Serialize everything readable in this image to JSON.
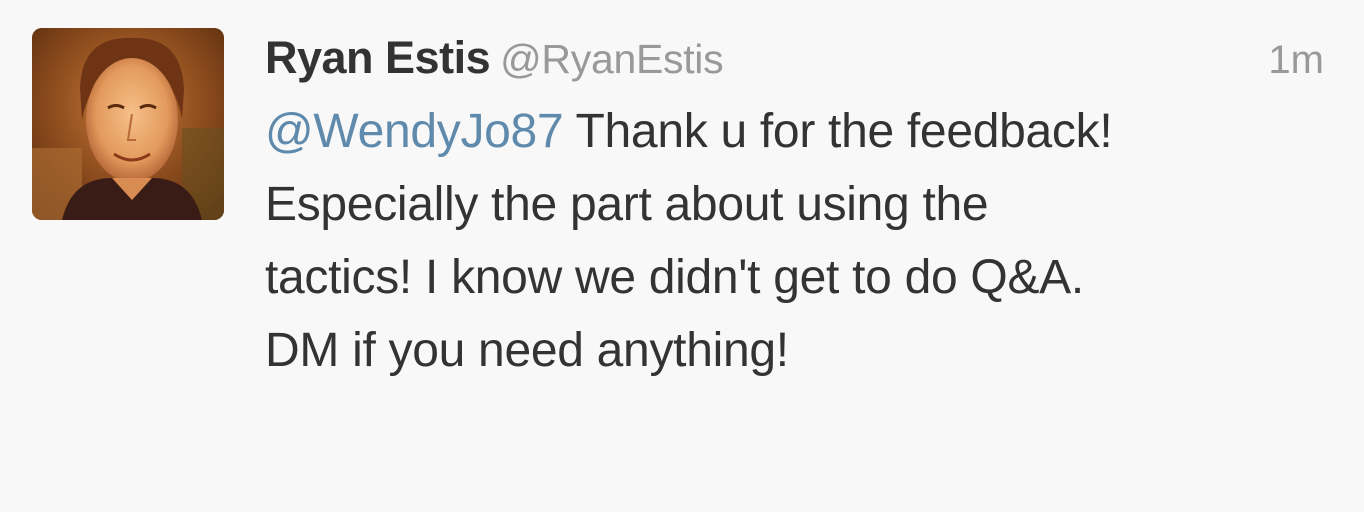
{
  "tweet": {
    "author": {
      "fullname": "Ryan Estis",
      "username": "@RyanEstis"
    },
    "timestamp": "1m",
    "mention": "@WendyJo87",
    "text_lines": [
      " Thank u for the feedback!",
      "Especially the part about using the",
      "tactics! I know we didn't get to do Q&A.",
      "DM if you need anything!"
    ]
  },
  "colors": {
    "background": "#f8f8f8",
    "text": "#333333",
    "secondary": "#999999",
    "link": "#5f8aac"
  }
}
